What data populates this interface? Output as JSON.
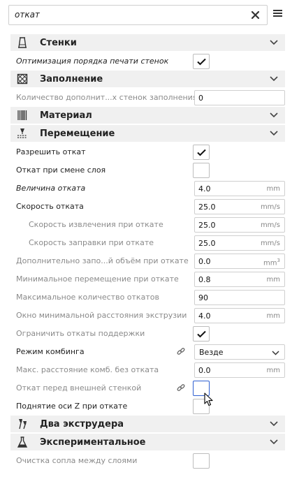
{
  "search": {
    "value": "откат"
  },
  "sections": [
    {
      "title": "Стенки",
      "icon": "walls-icon"
    },
    {
      "title": "Заполнение",
      "icon": "infill-icon"
    },
    {
      "title": "Материал",
      "icon": "material-icon"
    },
    {
      "title": "Перемещение",
      "icon": "travel-icon"
    },
    {
      "title": "Два экструдера",
      "icon": "dual-extruder-icon"
    },
    {
      "title": "Экспериментальное",
      "icon": "experimental-icon"
    }
  ],
  "walls": {
    "optimize_label": "Оптимизация порядка печати стенок",
    "optimize_checked": true
  },
  "infill": {
    "extra_walls_label": "Количество дополнит...х стенок заполнения",
    "extra_walls_value": "0"
  },
  "travel": {
    "enable_retraction": {
      "label": "Разрешить откат",
      "checked": true
    },
    "retract_layer_change": {
      "label": "Откат при смене слоя",
      "checked": false
    },
    "retraction_amount": {
      "label": "Величина отката",
      "value": "4.0",
      "unit": "mm"
    },
    "retraction_speed": {
      "label": "Скорость отката",
      "value": "25.0",
      "unit": "mm/s"
    },
    "retraction_retract_speed": {
      "label": "Скорость извлечения при откате",
      "value": "25.0",
      "unit": "mm/s"
    },
    "retraction_prime_speed": {
      "label": "Скорость заправки при откате",
      "value": "25.0",
      "unit": "mm/s"
    },
    "extra_prime_amount": {
      "label": "Дополнительно запо...й объём при откате",
      "value": "0.0",
      "unit": "mm"
    },
    "min_travel": {
      "label": "Минимальное перемещение при откате",
      "value": "0.8",
      "unit": "mm"
    },
    "max_count": {
      "label": "Максимальное количество откатов",
      "value": "90"
    },
    "extrusion_window": {
      "label": "Окно минимальной расстояния экструзии",
      "value": "4.0",
      "unit": "mm"
    },
    "limit_support_retractions": {
      "label": "Ограничить откаты поддержки",
      "checked": true
    },
    "combing_mode": {
      "label": "Режим комбинга",
      "value": "Везде"
    },
    "max_comb_distance": {
      "label": "Макс. расстояние комб. без отката",
      "value": "0.0",
      "unit": "mm"
    },
    "retract_before_outer_wall": {
      "label": "Откат перед внешней стенкой",
      "checked": false
    },
    "z_hop": {
      "label": "Поднятие оси Z при откате",
      "checked": false
    }
  },
  "experimental": {
    "nozzle_wipe_label": "Очистка сопла между слоями",
    "nozzle_wipe_checked": false
  },
  "colors": {
    "section_bg": "#f0f0f0",
    "focus_border": "#2e5fd1",
    "grey_label": "#8a8a8a"
  }
}
